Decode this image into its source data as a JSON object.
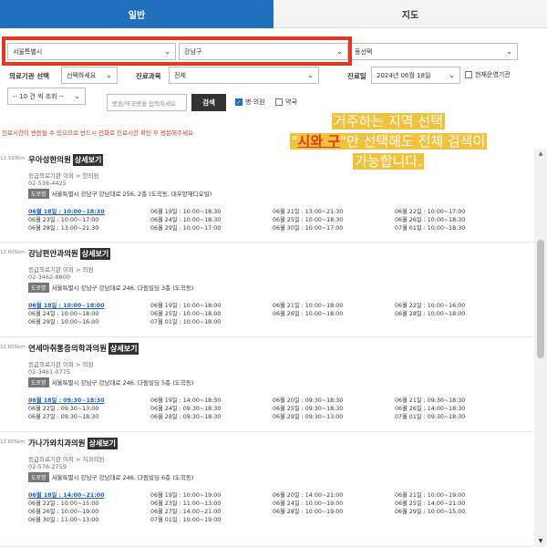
{
  "tabs": [
    {
      "label": "일반"
    },
    {
      "label": "지도"
    }
  ],
  "filters": {
    "city": {
      "value": "서울특별시"
    },
    "district": {
      "value": "강남구"
    },
    "dong": {
      "value": "동선택"
    },
    "type_label": "의료기관 선택",
    "type": {
      "value": "선택하세요"
    },
    "subject_label": "진료과목",
    "subject": {
      "value": "전체"
    },
    "date_label": "진료일",
    "date": {
      "value": "2024년 06월 18일"
    },
    "open_now_label": "현재운영기관",
    "page_size": {
      "value": "-- 10 건 씩 조회 --"
    },
    "search_placeholder": "병원/약국명을 입력하세요",
    "search_button": "검색",
    "hospital_label": "병·의원",
    "hospital_checked": true,
    "pharmacy_label": "약국",
    "pharmacy_checked": false
  },
  "notice": "진료시간이 변동될 수 있으므로 반드시 전화로 진료시간 확인 후 방문해주세요",
  "overlay": {
    "line1": "거주하는 지역 선택",
    "quote_open": "\"",
    "em": "시와 구",
    "line2_rest": "\"만 선택해도 전체 검색이",
    "line3": "가능합니다."
  },
  "detail_label": "상세보기",
  "road_tag": "도로명",
  "clinics": [
    {
      "distance": "12.599km",
      "name": "우아성한의원",
      "category": "응급의료기관 이외 > 한의원",
      "phone": "02-538-4425",
      "address": "서울특별시 강남구 강남대로 256, 2층 (도곡동, 대우양재디오빌)",
      "hours": [
        [
          "06월 18일 : 10:00~18:30",
          "06월 19일 : 10:00~18:30",
          "06월 21일 : 13:00~21:30",
          "06월 22일 : 10:00~17:00"
        ],
        [
          "06월 23일 : 10:00~17:00",
          "06월 24일 : 10:00~18:30",
          "06월 25일 : 10:00~18:30",
          "06월 26일 : 10:00~18:30"
        ],
        [
          "06월 28일 : 13:00~21:30",
          "06월 29일 : 10:00~17:00",
          "06월 30일 : 10:00~17:00",
          "07월 01일 : 10:00~18:30"
        ]
      ]
    },
    {
      "distance": "12.605km",
      "name": "강남편안과의원",
      "category": "응급의료기관 이외 > 의원",
      "phone": "02-3462-8800",
      "address": "서울특별시 강남구 강남대로 246, 다림빌딩 3층 (도곡동)",
      "hours": [
        [
          "06월 18일 : 10:00~18:00",
          "06월 19일 : 10:00~18:00",
          "06월 21일 : 10:00~18:00",
          "06월 22일 : 10:00~16:00"
        ],
        [
          "06월 24일 : 10:00~18:00",
          "06월 25일 : 10:00~18:00",
          "06월 26일 : 10:00~18:00",
          "06월 28일 : 10:00~18:00"
        ],
        [
          "06월 29일 : 10:00~16:00",
          "07월 01일 : 10:00~18:00",
          "",
          ""
        ]
      ]
    },
    {
      "distance": "12.605km",
      "name": "연세마취통증의학과의원",
      "category": "응급의료기관 이외 > 의원",
      "phone": "02-3461-0775",
      "address": "서울특별시 강남구 강남대로 246, 다림빌딩 5층 (도곡동)",
      "hours": [
        [
          "06월 18일 : 09:30~18:30",
          "06월 19일 : 14:00~18:30",
          "06월 20일 : 09:30~18:30",
          "06월 21일 : 09:30~18:30"
        ],
        [
          "06월 22일 : 09:30~13:00",
          "06월 24일 : 09:30~18:30",
          "06월 25일 : 09:30~18:30",
          "06월 26일 : 14:00~18:30"
        ],
        [
          "06월 27일 : 09:30~18:30",
          "06월 28일 : 09:30~18:30",
          "06월 29일 : 09:30~13:00",
          "07월 01일 : 09:30~18:30"
        ]
      ]
    },
    {
      "distance": "12.605km",
      "name": "가나가와치과의원",
      "category": "응급의료기관 이외 > 치과의원",
      "phone": "02-578-2759",
      "address": "서울특별시 강남구 강남대로 246, 다림빌딩 6층 (도곡동)",
      "hours": [
        [
          "06월 18일 : 14:00~21:00",
          "06월 19일 : 10:00~19:00",
          "06월 20일 : 14:00~21:00",
          "06월 21일 : 10:00~19:00"
        ],
        [
          "06월 22일 : 10:00~15:00",
          "06월 23일 : 11:00~13:00",
          "06월 24일 : 10:00~19:00",
          "06월 25일 : 14:00~21:00"
        ],
        [
          "06월 26일 : 10:00~19:00",
          "06월 27일 : 14:00~21:00",
          "06월 28일 : 10:00~19:00",
          "06월 29일 : 10:00~15:00"
        ],
        [
          "06월 30일 : 11:00~13:00",
          "07월 01일 : 10:00~19:00",
          "",
          ""
        ]
      ]
    }
  ]
}
